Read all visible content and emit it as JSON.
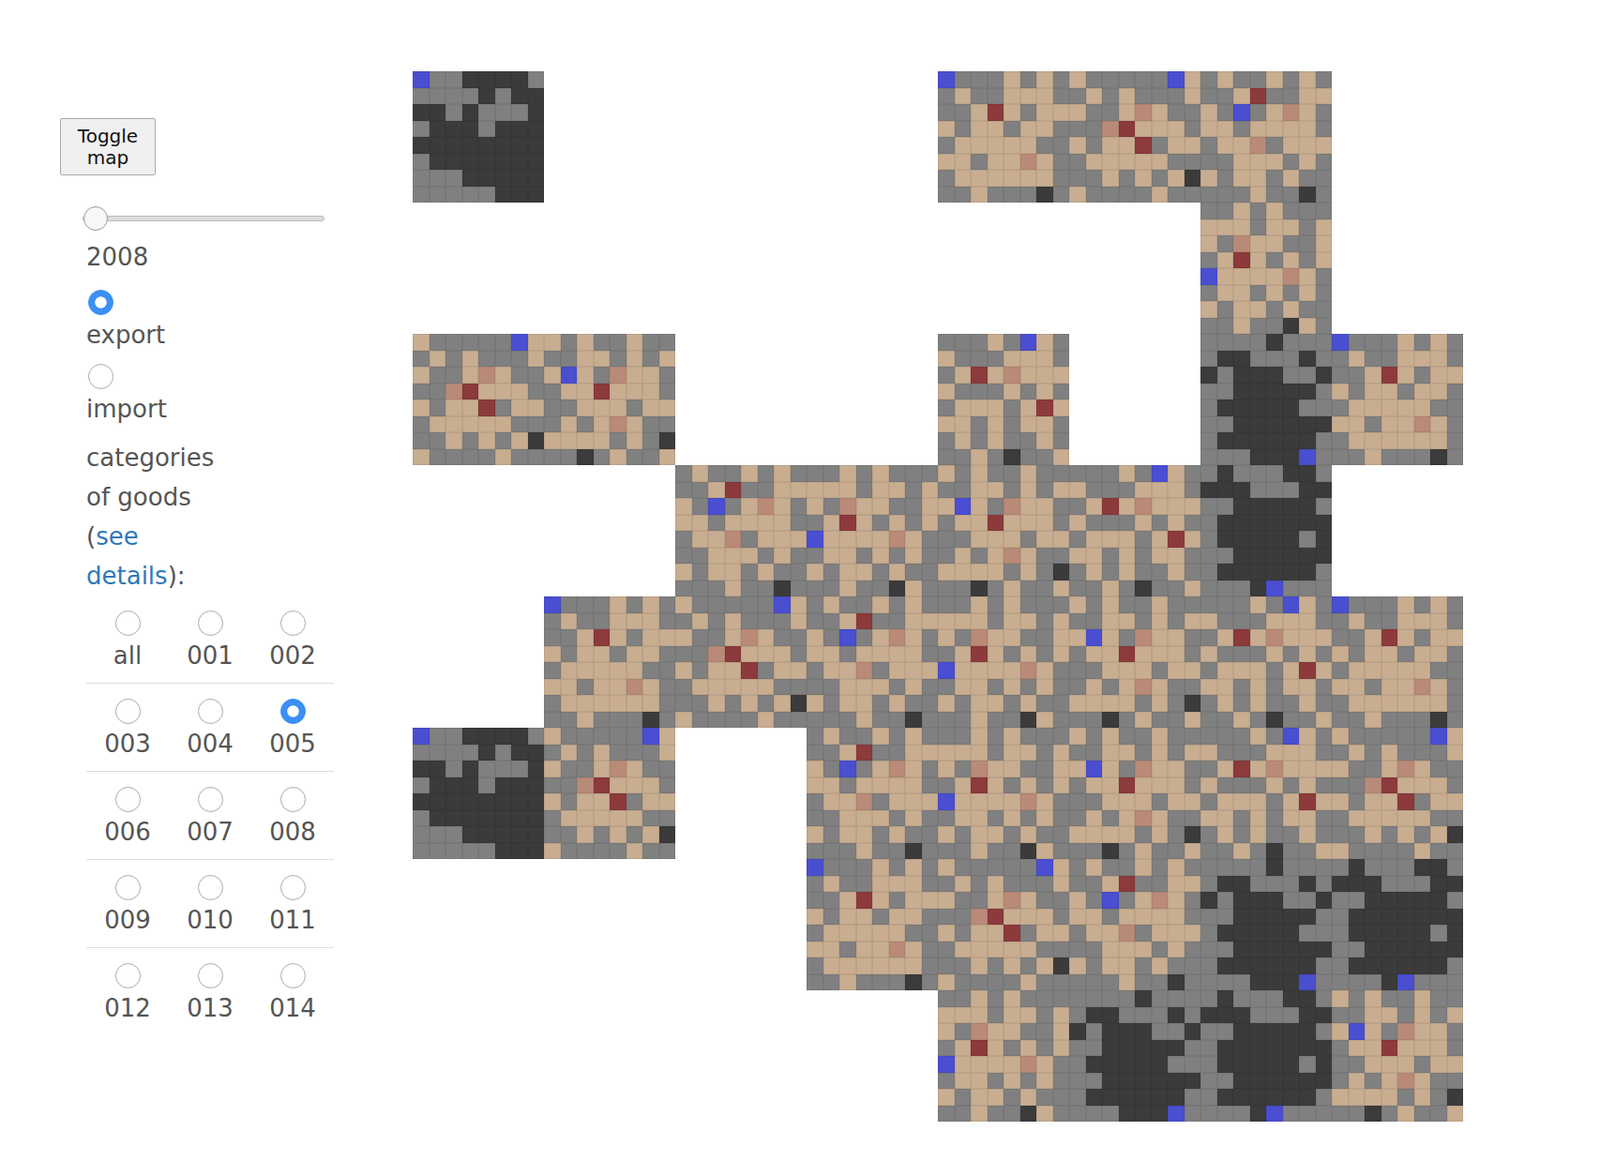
{
  "controls": {
    "toggle_button": "Toggle map",
    "year": {
      "level": 0,
      "reading": "2008"
    },
    "flow": [
      {
        "label": "export",
        "selected": true
      },
      {
        "label": "import",
        "selected": false
      }
    ],
    "categories": {
      "heading_before": "categories of goods (",
      "link": "see details",
      "heading_after": "):",
      "options": [
        {
          "label": "all",
          "selected": false
        },
        {
          "label": "001",
          "selected": false
        },
        {
          "label": "002",
          "selected": false
        },
        {
          "label": "003",
          "selected": false
        },
        {
          "label": "004",
          "selected": false
        },
        {
          "label": "005",
          "selected": true
        },
        {
          "label": "006",
          "selected": false
        },
        {
          "label": "007",
          "selected": false
        },
        {
          "label": "008",
          "selected": false
        },
        {
          "label": "009",
          "selected": false
        },
        {
          "label": "010",
          "selected": false
        },
        {
          "label": "011",
          "selected": false
        },
        {
          "label": "012",
          "selected": false
        },
        {
          "label": "013",
          "selected": false
        },
        {
          "label": "014",
          "selected": false
        }
      ]
    }
  },
  "map": {
    "palette": {
      "g": "#808080",
      "d": "#3b3b3b",
      "t": "#c8ad90",
      "b": "#4a4ed0",
      "r": "#8c3a3c",
      "p": "#b98a78"
    },
    "patterns": {
      "D1": [
        "bggddddg",
        "ggggdgdd",
        "ddgdgggd",
        "gdddgddd",
        "dddddddd",
        "gddddddd",
        "gggddddd",
        "gggggddd"
      ],
      "D2": [
        "ggggdggg",
        "gddgggdg",
        "dgdddggd",
        "ggdddddg",
        "gdddddgg",
        "ggdddddd",
        "gddddddg",
        "gggdddbg"
      ],
      "D3": [
        "gdgggddg",
        "dddgggdd",
        "ggdddddg",
        "gddddddd",
        "gdddddgd",
        "ggdddddd",
        "gddddddg",
        "gggdbggg"
      ],
      "A1": [
        "bgggtgtg",
        "gtggtttg",
        "ggtrtgtt",
        "tgttgttg",
        "gtttttgg",
        "ttgttptg",
        "gttttttg",
        "ggtgggdg"
      ],
      "A2": [
        "tgggggbt",
        "gtgtgggt",
        "tggtptgg",
        "ggprtttg",
        "tgttrgtt",
        "gtttttgg",
        "ggtgtgtd",
        "tggggtgg"
      ],
      "A3": [
        "gtggtgtg",
        "ggtrggtt",
        "tgbgtptg",
        "ttgttttg",
        "gttpgttt",
        "ggtttgtg",
        "tgttgtgg",
        "gggtggdg"
      ],
      "A4": [
        "ggtgtggg",
        "tttgttgt",
        "tgpttggt",
        "gtrtgtgt",
        "bttttptg",
        "gttgtgtg",
        "tgttgtgg",
        "ggtggdtg"
      ],
      "A5": [
        "tgtggtgg",
        "ggttgtgt",
        "tbtgpttg",
        "gttrtttg",
        "ggtttgtt",
        "gtgtptgg",
        "ttttgtgd",
        "ggdgtggt"
      ],
      "A6": [
        "gggtgbtg",
        "tgggtttg",
        "gtrtpttt",
        "tgggtgtg",
        "gtttgtrt",
        "ttgtgttg",
        "gtgtggtg",
        "ggtgdggt"
      ]
    },
    "blocks": [
      {
        "row": 0,
        "col": 0,
        "pattern": "D1"
      },
      {
        "row": 0,
        "col": 4,
        "pattern": "A1"
      },
      {
        "row": 0,
        "col": 5,
        "pattern": "A2"
      },
      {
        "row": 0,
        "col": 6,
        "pattern": "A3"
      },
      {
        "row": 1,
        "col": 6,
        "pattern": "A4"
      },
      {
        "row": 2,
        "col": 0,
        "pattern": "A2"
      },
      {
        "row": 2,
        "col": 1,
        "pattern": "A5"
      },
      {
        "row": 2,
        "col": 4,
        "pattern": "A6"
      },
      {
        "row": 2,
        "col": 6,
        "pattern": "D2"
      },
      {
        "row": 2,
        "col": 7,
        "pattern": "A1"
      },
      {
        "row": 3,
        "col": 2,
        "pattern": "A3"
      },
      {
        "row": 3,
        "col": 3,
        "pattern": "A4"
      },
      {
        "row": 3,
        "col": 4,
        "pattern": "A5"
      },
      {
        "row": 3,
        "col": 5,
        "pattern": "A6"
      },
      {
        "row": 3,
        "col": 6,
        "pattern": "D3"
      },
      {
        "row": 4,
        "col": 1,
        "pattern": "A1"
      },
      {
        "row": 4,
        "col": 2,
        "pattern": "A2"
      },
      {
        "row": 4,
        "col": 3,
        "pattern": "A3"
      },
      {
        "row": 4,
        "col": 4,
        "pattern": "A4"
      },
      {
        "row": 4,
        "col": 5,
        "pattern": "A5"
      },
      {
        "row": 4,
        "col": 6,
        "pattern": "A6"
      },
      {
        "row": 4,
        "col": 7,
        "pattern": "A1"
      },
      {
        "row": 5,
        "col": 0,
        "pattern": "D1"
      },
      {
        "row": 5,
        "col": 1,
        "pattern": "A2"
      },
      {
        "row": 5,
        "col": 3,
        "pattern": "A3"
      },
      {
        "row": 5,
        "col": 4,
        "pattern": "A4"
      },
      {
        "row": 5,
        "col": 5,
        "pattern": "A5"
      },
      {
        "row": 5,
        "col": 6,
        "pattern": "A6"
      },
      {
        "row": 5,
        "col": 7,
        "pattern": "A2"
      },
      {
        "row": 6,
        "col": 3,
        "pattern": "A1"
      },
      {
        "row": 6,
        "col": 4,
        "pattern": "A2"
      },
      {
        "row": 6,
        "col": 5,
        "pattern": "A3"
      },
      {
        "row": 6,
        "col": 6,
        "pattern": "D2"
      },
      {
        "row": 6,
        "col": 7,
        "pattern": "D3"
      },
      {
        "row": 7,
        "col": 4,
        "pattern": "A4"
      },
      {
        "row": 7,
        "col": 5,
        "pattern": "D2"
      },
      {
        "row": 7,
        "col": 6,
        "pattern": "D3"
      },
      {
        "row": 7,
        "col": 7,
        "pattern": "A5"
      }
    ]
  }
}
